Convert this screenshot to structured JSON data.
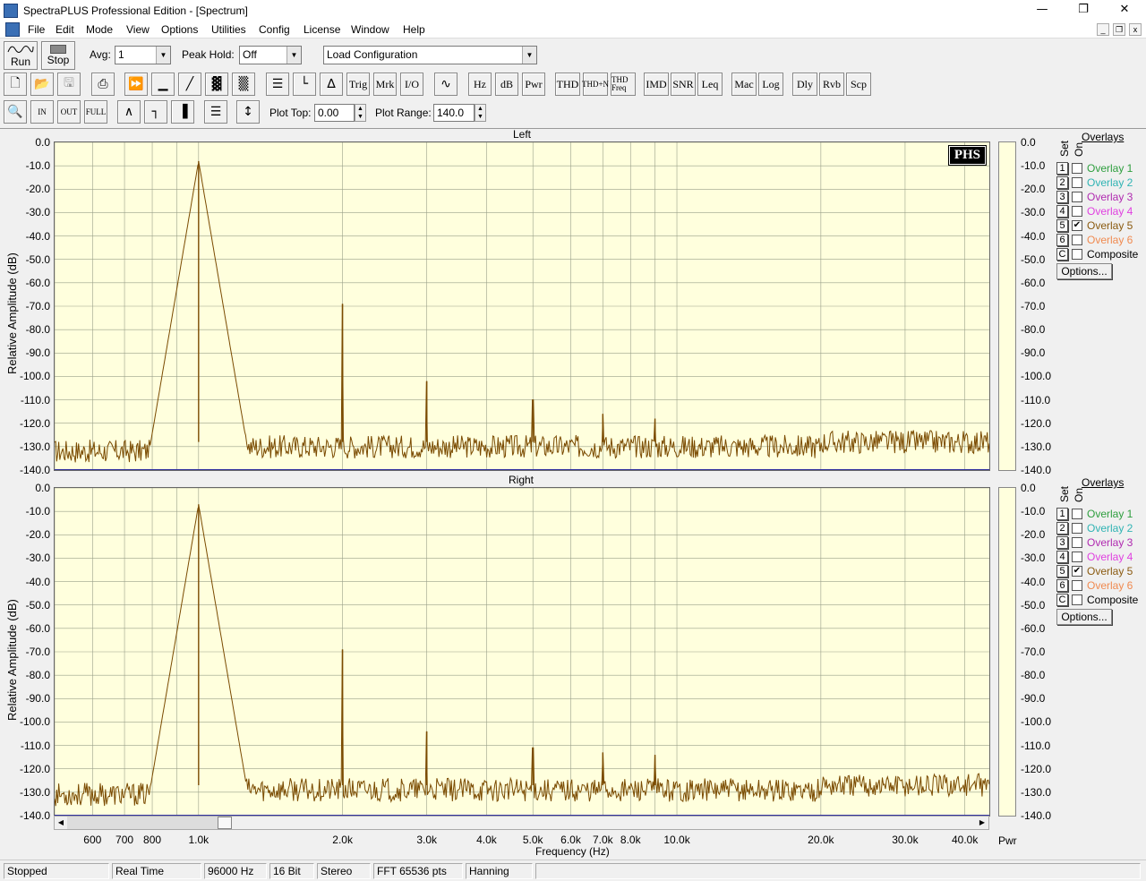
{
  "window": {
    "title": "SpectraPLUS Professional Edition - [Spectrum]"
  },
  "menu": [
    "File",
    "Edit",
    "Mode",
    "View",
    "Options",
    "Utilities",
    "Config",
    "License",
    "Window",
    "Help"
  ],
  "toolbar1": {
    "run_label": "Run",
    "stop_label": "Stop",
    "avg_label": "Avg:",
    "avg_value": "1",
    "peakhold_label": "Peak Hold:",
    "peakhold_value": "Off",
    "config_value": "Load Configuration"
  },
  "toolbar2": [
    "Trig",
    "Mrk",
    "I/O",
    "Hz",
    "dB",
    "Pwr",
    "THD",
    "THD+N",
    "THD Freq",
    "IMD",
    "SNR",
    "Leq",
    "Mac",
    "Log",
    "Dly",
    "Rvb",
    "Scp"
  ],
  "toolbar3": {
    "plot_top_label": "Plot Top:",
    "plot_top_value": "0.00",
    "plot_range_label": "Plot Range:",
    "plot_range_value": "140.0"
  },
  "panels": [
    {
      "title": "Left",
      "ylabel": "Relative Amplitude (dB)"
    },
    {
      "title": "Right",
      "ylabel": "Relative Amplitude (dB)"
    }
  ],
  "logo": "PHS",
  "overlays": {
    "title": "Overlays",
    "set_label": "Set",
    "on_label": "On",
    "items": [
      {
        "num": "1",
        "label": "Overlay 1",
        "color": "#2e9e3e",
        "checked": false
      },
      {
        "num": "2",
        "label": "Overlay 2",
        "color": "#2fb3b3",
        "checked": false
      },
      {
        "num": "3",
        "label": "Overlay 3",
        "color": "#b02ab0",
        "checked": false
      },
      {
        "num": "4",
        "label": "Overlay 4",
        "color": "#e040e0",
        "checked": false
      },
      {
        "num": "5",
        "label": "Overlay 5",
        "color": "#8a5a10",
        "checked": true
      },
      {
        "num": "6",
        "label": "Overlay 6",
        "color": "#f08a50",
        "checked": false
      },
      {
        "num": "C",
        "label": "Composite",
        "color": "#000000",
        "checked": false
      }
    ],
    "options_label": "Options..."
  },
  "pwr_label": "Pwr",
  "xaxis_label": "Frequency (Hz)",
  "status": [
    "Stopped",
    "Real Time",
    "96000 Hz",
    "16 Bit",
    "Stereo",
    "FFT 65536 pts",
    "Hanning"
  ],
  "chart_data": {
    "type": "line",
    "x_scale": "log",
    "xlabel": "Frequency (Hz)",
    "ylabel": "Relative Amplitude (dB)",
    "xlim": [
      500,
      45000
    ],
    "ylim": [
      -140,
      0
    ],
    "yticks": [
      0,
      -10,
      -20,
      -30,
      -40,
      -50,
      -60,
      -70,
      -80,
      -90,
      -100,
      -110,
      -120,
      -130,
      -140
    ],
    "ytick_labels": [
      "0.0",
      "-10.0",
      "-20.0",
      "-30.0",
      "-40.0",
      "-50.0",
      "-60.0",
      "-70.0",
      "-80.0",
      "-90.0",
      "-100.0",
      "-110.0",
      "-120.0",
      "-130.0",
      "-140.0"
    ],
    "xticks": [
      600,
      700,
      800,
      1000,
      2000,
      3000,
      4000,
      5000,
      6000,
      7000,
      8000,
      10000,
      20000,
      30000,
      40000
    ],
    "xtick_labels": [
      "600",
      "700",
      "800",
      "1.0k",
      "2.0k",
      "3.0k",
      "4.0k",
      "5.0k",
      "6.0k",
      "7.0k",
      "8.0k",
      "10.0k",
      "20.0k",
      "30.0k",
      "40.0k"
    ],
    "series": [
      {
        "color": "#7a4a00",
        "noise_floor": -128,
        "peaks": [
          [
            1000,
            -8
          ],
          [
            2000,
            -69
          ],
          [
            3000,
            -102
          ],
          [
            5000,
            -110
          ],
          [
            7000,
            -116
          ],
          [
            9000,
            -118
          ]
        ]
      },
      {
        "color": "#7a4a00",
        "noise_floor": -127,
        "peaks": [
          [
            1000,
            -7
          ],
          [
            2000,
            -69
          ],
          [
            3000,
            -104
          ],
          [
            5000,
            -111
          ],
          [
            7000,
            -113
          ],
          [
            9000,
            -114
          ]
        ]
      }
    ]
  }
}
